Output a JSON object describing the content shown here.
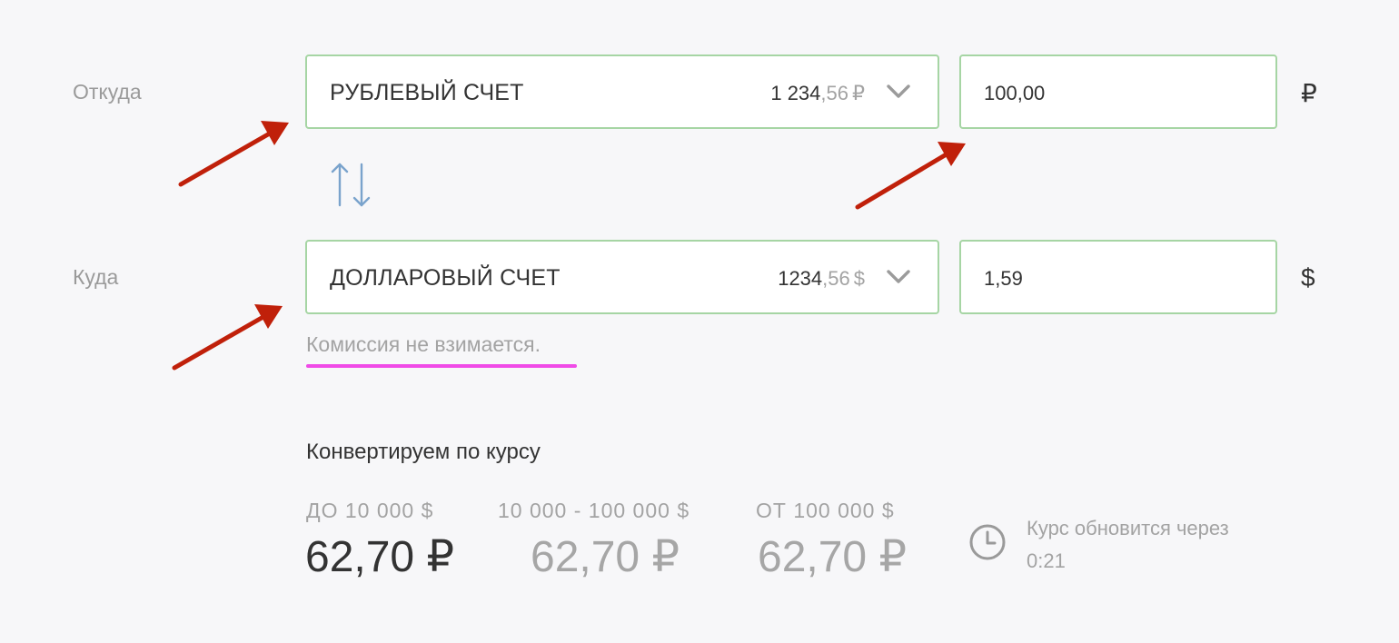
{
  "from": {
    "label": "Откуда",
    "account": {
      "name": "РУБЛЕВЫЙ СЧЕТ",
      "balance_int": "1 234",
      "balance_frac": ",56",
      "balance_currency": "₽"
    },
    "amount": "100,00",
    "currency_sign": "₽"
  },
  "to": {
    "label": "Куда",
    "account": {
      "name": "ДОЛЛАРОВЫЙ СЧЕТ",
      "balance_int": "1234",
      "balance_frac": ",56",
      "balance_currency": "$"
    },
    "amount": "1,59",
    "currency_sign": "$"
  },
  "commission_note": "Комиссия не взимается.",
  "rates": {
    "title": "Конвертируем по курсу",
    "tiers": [
      {
        "label": "ДО 10 000 $",
        "rate": "62,70 ₽",
        "active": true
      },
      {
        "label": "10 000 - 100 000 $",
        "rate": "62,70 ₽",
        "active": false
      },
      {
        "label": "ОТ 100 000 $",
        "rate": "62,70 ₽",
        "active": false
      }
    ],
    "update_text_line1": "Курс обновится через",
    "update_time": "0:21"
  },
  "icons": {
    "swap": "swap-arrows-icon",
    "chevron": "chevron-down-icon",
    "clock": "clock-icon"
  },
  "colors": {
    "field_border": "#a6d5a4",
    "swap_icon": "#7aa3cc",
    "annotation_arrow": "#c0200a",
    "annotation_underline": "#f04be7",
    "muted_text": "#a3a3a3"
  }
}
